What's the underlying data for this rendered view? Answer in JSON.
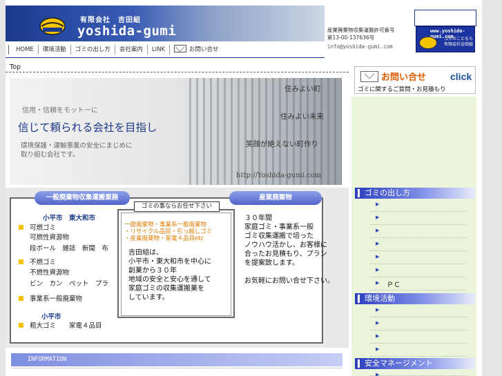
{
  "header": {
    "company_jp": "有限会社　吉田組",
    "company_en": "yoshida-gumi",
    "license_line1": "産業廃棄物収集運搬許可番号",
    "license_line2": "第13-00-137636号",
    "email": "info@yoshida-gumi.com"
  },
  "nav": {
    "items": [
      "HOME",
      "環境活動",
      "ゴミの出し方",
      "会社案内",
      "LINK",
      "お問い合せ"
    ]
  },
  "banner_right": {
    "url_text": "www.yoshida-gumi.com",
    "tagline": "ゴミのことなら 有限会社吉田組"
  },
  "breadcrumb": "Top",
  "hero": {
    "tagline": "信用・信頼をモットーに",
    "main": "信じて頼られる会社を目指し",
    "desc1": "環境保護・運輸事業の安全にまじめに",
    "desc2": "取り組む会社です。",
    "phrase1": "住みよい町",
    "phrase2": "住みよい未来",
    "phrase3": "笑顔が絶えない町作り",
    "url": "http://Yoshida-gumi.com"
  },
  "services": {
    "tab_left": "一般廃棄物収集運搬業務",
    "tab_right": "産業廃棄物",
    "center_title": "ゴミの事ならお任せ下さい",
    "orange_lines": [
      "一般廃棄物・事業系一般廃棄物",
      "・リサイクル品目・引っ越しゴミ",
      "・産業廃棄物・家電４品目etc"
    ],
    "center_text": [
      "吉田組は、",
      "小平市・東大和市を中心に",
      "創業から３０年",
      "地域の安全と安心を通して",
      "家庭ゴミの収集運搬業を",
      "しています。"
    ],
    "area1": "小平市　東大和市",
    "burnable": "可燃ゴミ",
    "burnable_sub1": "可燃性資源物",
    "burnable_sub2": "段ボール　雑誌　新聞　布",
    "nonburnable": "不燃ゴミ",
    "nonburnable_sub1": "不燃性資源物",
    "nonburnable_sub2": "ビン　カン　ペット　プラ",
    "business": "事業系一般廃棄物",
    "area2": "小平市",
    "oversize": "粗大ゴミ　　家電４品目",
    "right_text": [
      "３０年間",
      "家庭ゴミ・事業系一般",
      "ゴミ収集運搬で培った",
      "ノウハウ活かし、お客様に",
      "合ったお見積もり、プラン",
      "を提案致します。",
      "",
      "お気軽にお問い合せ下さい。"
    ]
  },
  "info_bar": "INFORMATION",
  "contact": {
    "title": "お問い合せ",
    "click": "click",
    "sub": "ゴミに関するご質問・お見積もり"
  },
  "sidebar": {
    "sections": [
      {
        "title": "ゴミの出し方",
        "items": [
          "",
          "",
          "",
          "",
          "",
          "",
          "ＰＣ"
        ]
      },
      {
        "title": "環境活動",
        "items": [
          "",
          "",
          "",
          ""
        ]
      },
      {
        "title": "安全マネージメント",
        "items": [
          ""
        ]
      }
    ]
  },
  "colors": {
    "brand_blue": "#1a3a8f",
    "accent_orange": "#e07a00",
    "sidebar_green": "#e9f4d8",
    "bullet_yellow": "#f2c200"
  }
}
